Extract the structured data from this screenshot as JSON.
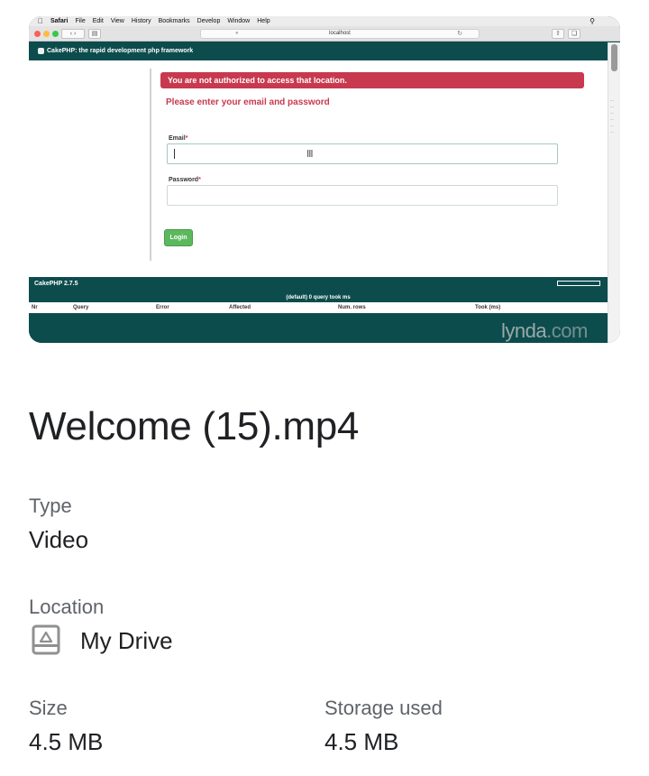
{
  "thumbnail": {
    "menubar": {
      "app": "Safari",
      "items": [
        "File",
        "Edit",
        "View",
        "History",
        "Bookmarks",
        "Develop",
        "Window",
        "Help"
      ]
    },
    "browser": {
      "url": "localhost"
    },
    "site": {
      "header_title": "CakePHP: the rapid development php framework",
      "alert": "You are not authorized to access that location.",
      "form_title": "Please enter your email and password",
      "email_label": "Email",
      "password_label": "Password",
      "required_mark": "*",
      "login_button": "Login",
      "version": "CakePHP 2.7.5",
      "sql_caption": "(default) 0 query took ms",
      "sql_columns": [
        "Nr",
        "Query",
        "Error",
        "Affected",
        "Num. rows",
        "Took (ms)"
      ]
    },
    "watermark": {
      "brand": "lynda",
      "suffix": ".com"
    }
  },
  "details": {
    "file_name": "Welcome (15).mp4",
    "type_label": "Type",
    "type_value": "Video",
    "location_label": "Location",
    "location_value": "My Drive",
    "location_icon": "drive-icon",
    "size_label": "Size",
    "size_value": "4.5 MB",
    "storage_label": "Storage used",
    "storage_value": "4.5 MB"
  }
}
